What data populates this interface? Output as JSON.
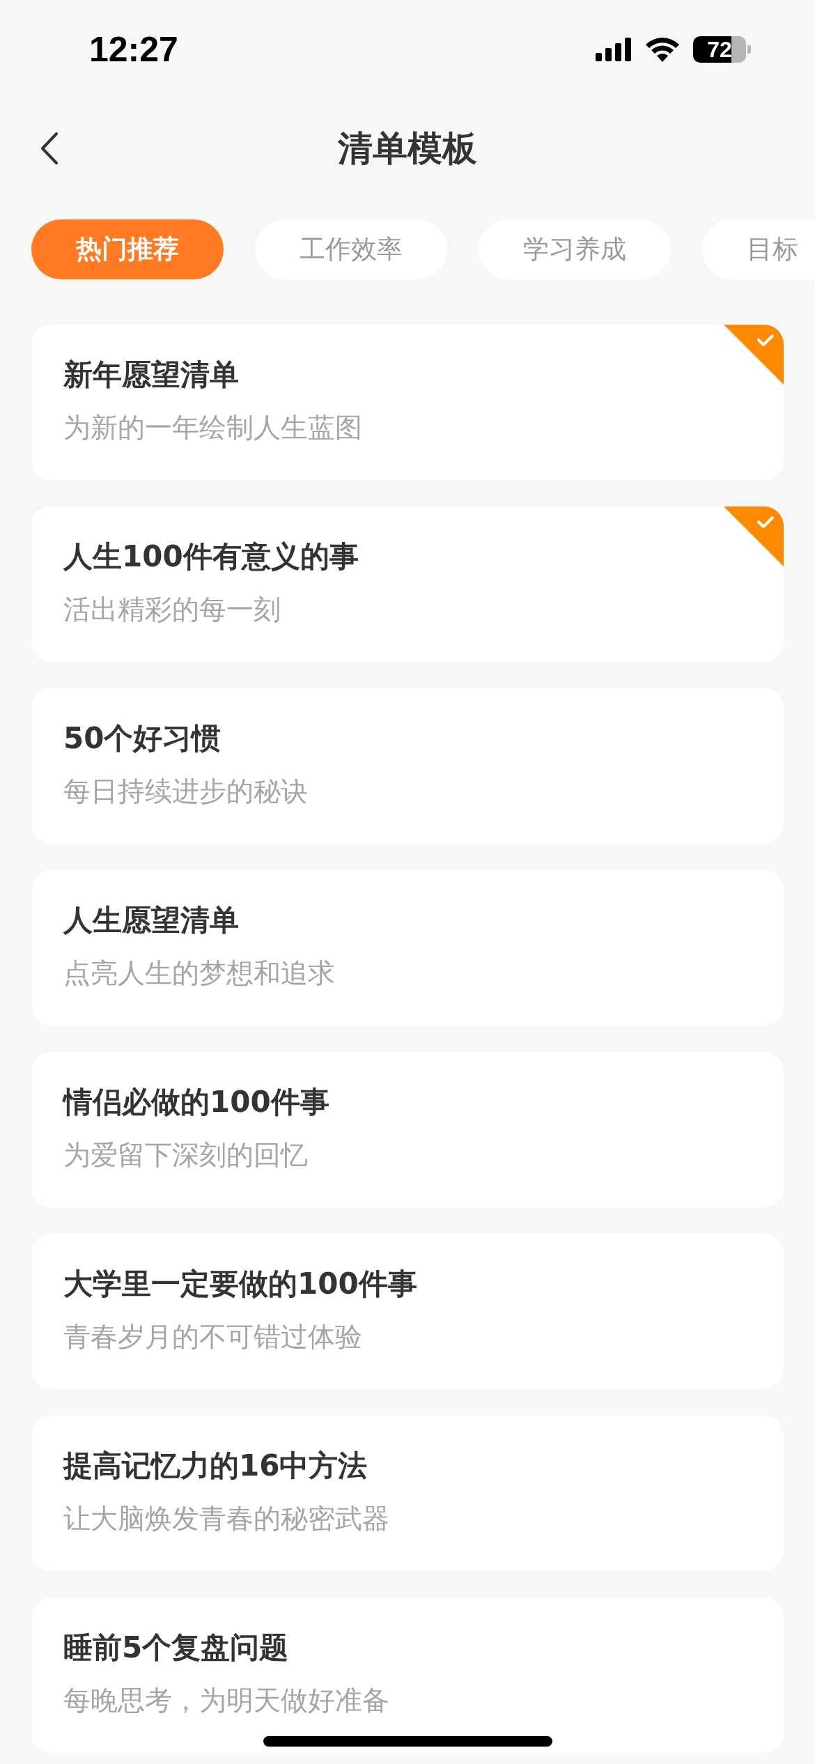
{
  "status_bar": {
    "time": "12:27",
    "battery": "72"
  },
  "nav": {
    "title": "清单模板"
  },
  "tabs": [
    {
      "label": "热门推荐",
      "selected": true
    },
    {
      "label": "工作效率",
      "selected": false
    },
    {
      "label": "学习养成",
      "selected": false
    },
    {
      "label": "目标",
      "selected": false
    }
  ],
  "templates": [
    {
      "title": "新年愿望清单",
      "subtitle": "为新的一年绘制人生蓝图",
      "checked": true
    },
    {
      "title": "人生100件有意义的事",
      "subtitle": "活出精彩的每一刻",
      "checked": true
    },
    {
      "title": "50个好习惯",
      "subtitle": "每日持续进步的秘诀",
      "checked": false
    },
    {
      "title": "人生愿望清单",
      "subtitle": "点亮人生的梦想和追求",
      "checked": false
    },
    {
      "title": "情侣必做的100件事",
      "subtitle": "为爱留下深刻的回忆",
      "checked": false
    },
    {
      "title": "大学里一定要做的100件事",
      "subtitle": "青春岁月的不可错过体验",
      "checked": false
    },
    {
      "title": "提高记忆力的16中方法",
      "subtitle": "让大脑焕发青春的秘密武器",
      "checked": false
    },
    {
      "title": "睡前5个复盘问题",
      "subtitle": "每晚思考，为明天做好准备",
      "checked": false
    }
  ]
}
